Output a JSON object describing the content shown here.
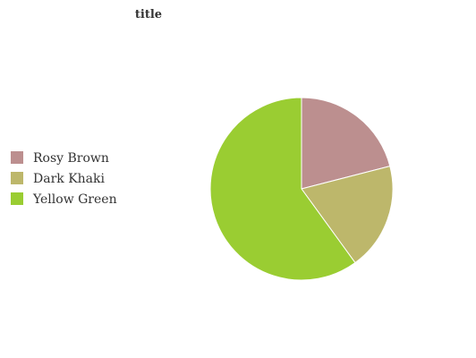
{
  "chart_data": {
    "type": "pie",
    "title": "title",
    "categories": [
      "Rosy Brown",
      "Dark Khaki",
      "Yellow Green"
    ],
    "values": [
      21,
      19,
      60
    ],
    "colors": [
      "#bc8f8f",
      "#bdb76b",
      "#9acd32"
    ],
    "legend_position": "left"
  }
}
